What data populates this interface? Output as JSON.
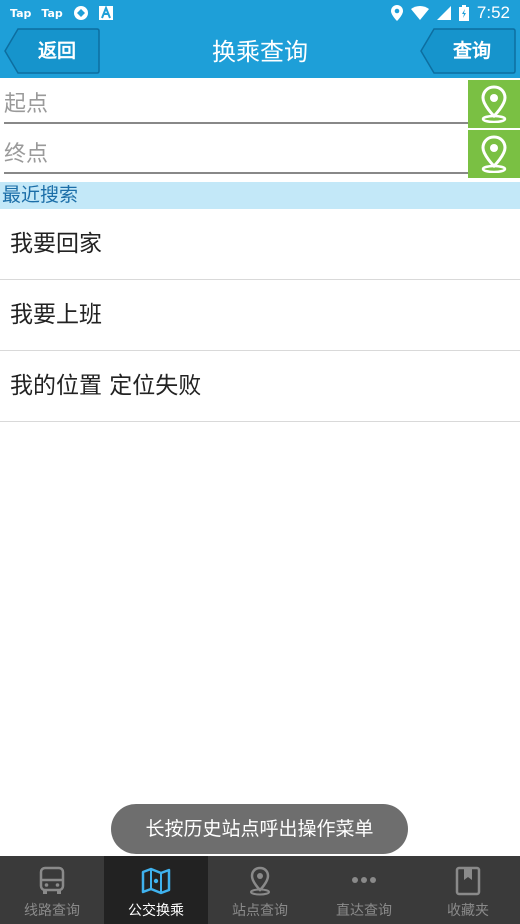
{
  "status_bar": {
    "apps": [
      "Tap",
      "Tap"
    ],
    "time": "7:52"
  },
  "header": {
    "back_label": "返回",
    "title": "换乘查询",
    "query_label": "查询"
  },
  "route": {
    "start_placeholder": "起点",
    "end_placeholder": "终点"
  },
  "recent": {
    "title": "最近搜索",
    "items": [
      "我要回家",
      "我要上班",
      "我的位置 定位失败"
    ]
  },
  "toast": "长按历史站点呼出操作菜单",
  "nav": {
    "items": [
      {
        "label": "线路查询",
        "icon": "bus-icon"
      },
      {
        "label": "公交换乘",
        "icon": "map-icon"
      },
      {
        "label": "站点查询",
        "icon": "location-pin-icon"
      },
      {
        "label": "直达查询",
        "icon": "more-dots-icon"
      },
      {
        "label": "收藏夹",
        "icon": "bookmark-icon"
      }
    ],
    "active_index": 1
  },
  "colors": {
    "primary": "#1e9fd8",
    "location_button": "#7ac043",
    "recent_header_bg": "#c3e8f8",
    "nav_bg": "#3a3a3a"
  }
}
